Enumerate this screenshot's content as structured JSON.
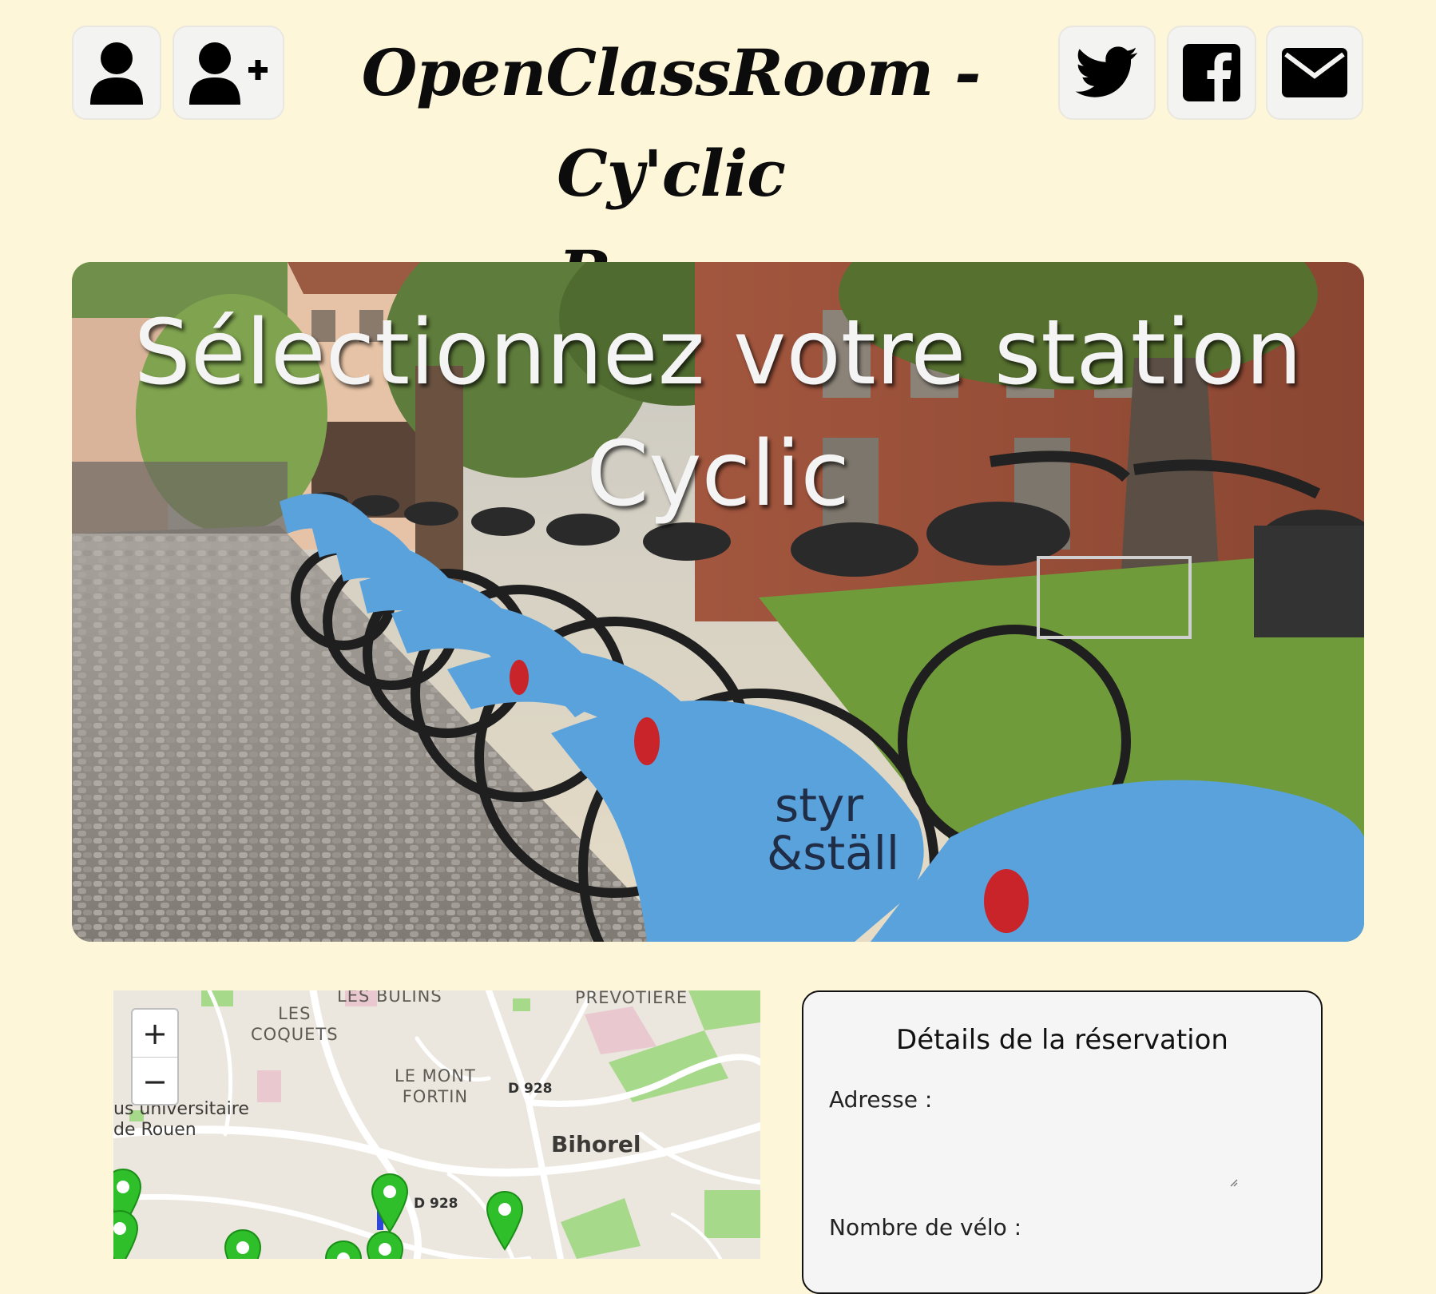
{
  "header": {
    "title_line1": "OpenClassRoom - Cy'clic",
    "title_line2": "Rouen"
  },
  "icons": {
    "login": "user-icon",
    "register": "user-plus-icon",
    "twitter": "twitter-icon",
    "facebook": "facebook-icon",
    "mail": "envelope-icon"
  },
  "hero": {
    "title_line1": "Sélectionnez votre station",
    "title_line2": "Cyclic"
  },
  "map": {
    "zoom_in": "+",
    "zoom_out": "−",
    "labels": {
      "les_bulins": "LES BULINS",
      "prevotiere": "PREVOTIERE",
      "les_coquets_1": "LES",
      "les_coquets_2": "COQUETS",
      "le_mont_1": "LE MONT",
      "le_mont_2": "FORTIN",
      "d928_a": "D 928",
      "d928_b": "D 928",
      "campus_1": "us universitaire",
      "campus_2": "de Rouen",
      "bihorel": "Bihorel"
    },
    "marker_color": "#2fbf2a"
  },
  "reservation": {
    "title": "Détails de la réservation",
    "address_label": "Adresse :",
    "bikes_label": "Nombre de vélo :"
  },
  "colors": {
    "page_background": "#fef6d9",
    "button_background": "#f3f3f1",
    "panel_background": "#f5f5f5"
  }
}
